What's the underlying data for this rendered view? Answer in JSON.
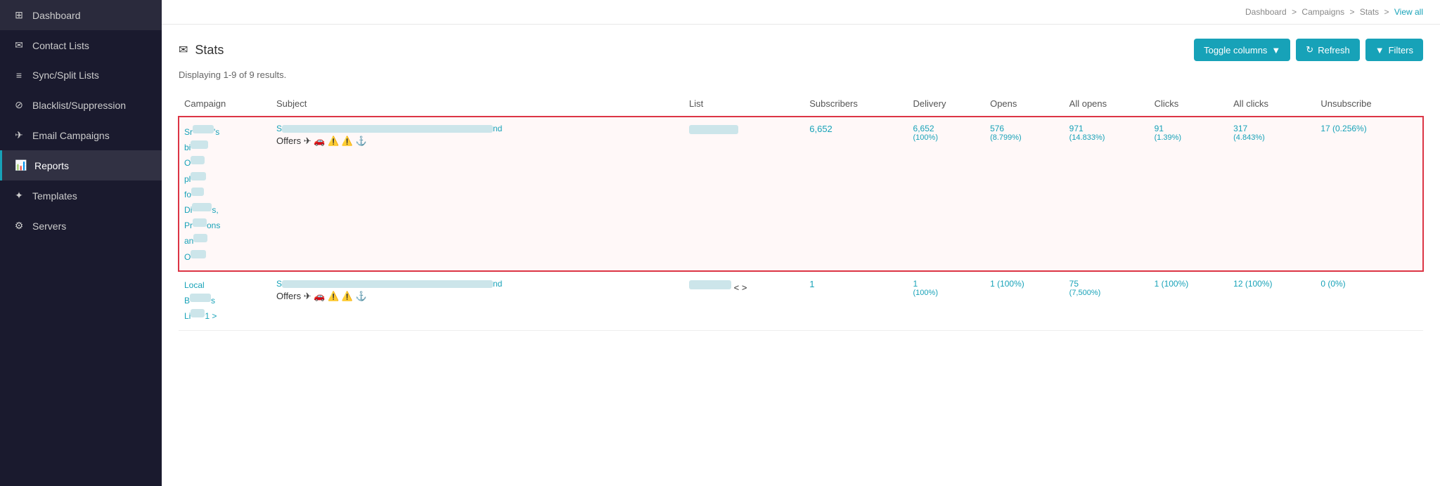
{
  "sidebar": {
    "items": [
      {
        "label": "Dashboard",
        "icon": "⊞",
        "name": "dashboard"
      },
      {
        "label": "Contact Lists",
        "icon": "✉",
        "name": "contact-lists"
      },
      {
        "label": "Sync/Split Lists",
        "icon": "≡",
        "name": "sync-split-lists"
      },
      {
        "label": "Blacklist/Suppression",
        "icon": "⊘",
        "name": "blacklist"
      },
      {
        "label": "Email Campaigns",
        "icon": "✈",
        "name": "email-campaigns"
      },
      {
        "label": "Reports",
        "icon": "📊",
        "name": "reports",
        "active": true
      },
      {
        "label": "Templates",
        "icon": "✦",
        "name": "templates"
      },
      {
        "label": "Servers",
        "icon": "⚙",
        "name": "servers"
      }
    ]
  },
  "breadcrumb": {
    "items": [
      "Dashboard",
      "Campaigns",
      "Stats"
    ],
    "active": "View all"
  },
  "page": {
    "title": "Stats",
    "title_icon": "✉",
    "displaying": "Displaying 1-9 of 9 results."
  },
  "toolbar": {
    "toggle_columns_label": "Toggle columns",
    "refresh_label": "Refresh",
    "filters_label": "Filters"
  },
  "table": {
    "headers": [
      "Campaign",
      "Subject",
      "List",
      "Subscribers",
      "Delivery",
      "Opens",
      "All opens",
      "Clicks",
      "All clicks",
      "Unsubscribe"
    ],
    "rows": [
      {
        "highlighted": true,
        "campaign": "Sr...a's bi... O... pl... fo... Di...s, Pr...ons an... O...",
        "subject_prefix": "S...",
        "subject_suffix": "nd",
        "subject_tags": "Offers ✈ 🚗 ⚠ ⚠ ⚓",
        "list": "[blurred]",
        "subscribers": "6,652",
        "delivery": "6,652 (100%)",
        "opens": "576 (8.799%)",
        "all_opens": "971 (14.833%)",
        "clicks": "91 (1.39%)",
        "all_clicks": "317 (4.843%)",
        "unsubscribe": "17 (0.256%)"
      },
      {
        "highlighted": false,
        "campaign": "Local B...s Li...1 >",
        "subject_prefix": "S...",
        "subject_suffix": "nd",
        "subject_tags": "Offers ✈ 🚗 ⚠ ⚠ ⚓",
        "list": "[blurred] < >",
        "subscribers": "1",
        "delivery": "1 (100%)",
        "opens": "1 (100%)",
        "all_opens": "75 (7,500%)",
        "clicks": "1 (100%)",
        "all_clicks": "12 (100%)",
        "unsubscribe": "0 (0%)"
      }
    ]
  }
}
